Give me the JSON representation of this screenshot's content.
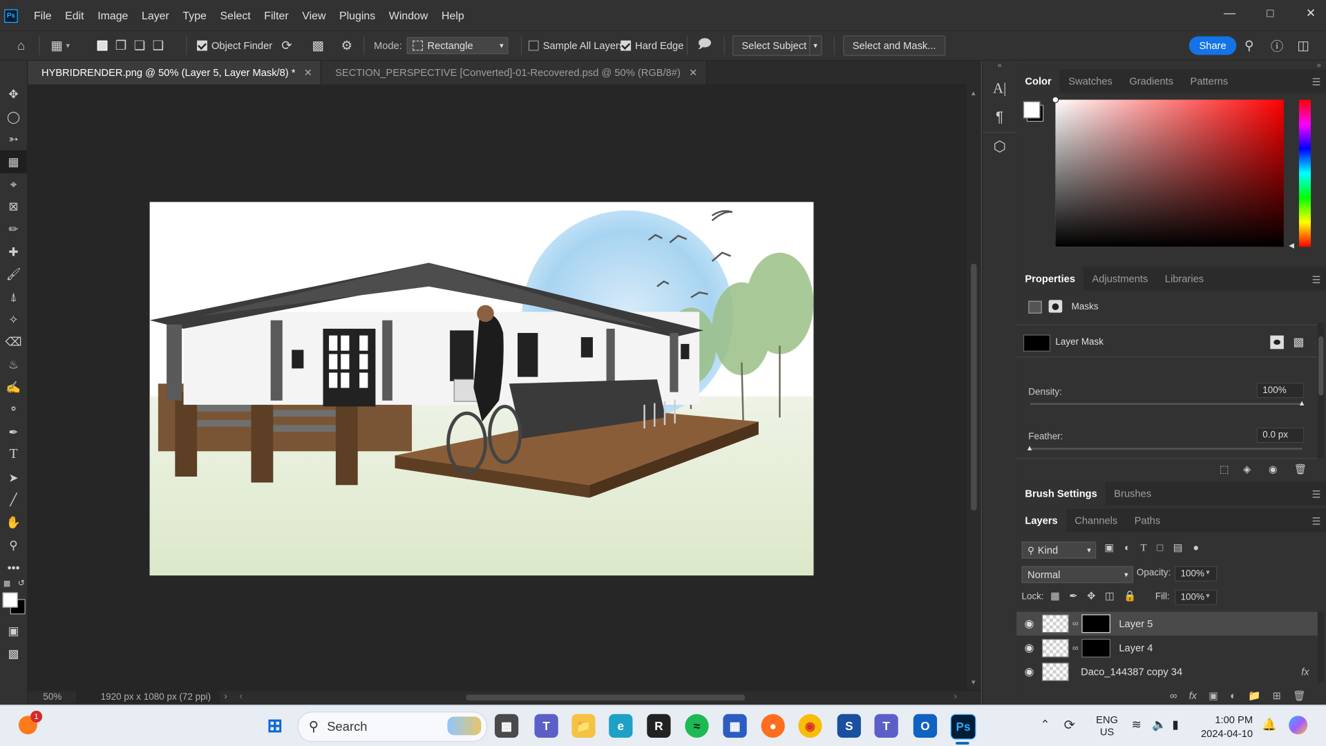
{
  "app": {
    "logo": "Ps",
    "menus": [
      "File",
      "Edit",
      "Image",
      "Layer",
      "Type",
      "Select",
      "Filter",
      "View",
      "Plugins",
      "Window",
      "Help"
    ]
  },
  "options": {
    "object_finder": "Object Finder",
    "mode_label": "Mode:",
    "mode_value": "Rectangle",
    "sample_all_layers": "Sample All Layers",
    "hard_edge": "Hard Edge",
    "select_subject": "Select Subject",
    "select_and_mask": "Select and Mask...",
    "share": "Share"
  },
  "tabs": [
    {
      "label": "HYBRIDRENDER.png @ 50% (Layer 5, Layer Mask/8) *",
      "active": true
    },
    {
      "label": "SECTION_PERSPECTIVE [Converted]-01-Recovered.psd @ 50% (RGB/8#)",
      "active": false
    }
  ],
  "status": {
    "zoom": "50%",
    "doc_info": "1920 px x 1080 px (72 ppi)"
  },
  "color_panel": {
    "tabs": [
      "Color",
      "Swatches",
      "Gradients",
      "Patterns"
    ]
  },
  "properties_panel": {
    "tabs": [
      "Properties",
      "Adjustments",
      "Libraries"
    ],
    "section": "Masks",
    "mask_label": "Layer Mask",
    "density_label": "Density:",
    "density_value": "100%",
    "density_fraction": 1.0,
    "feather_label": "Feather:",
    "feather_value": "0.0 px",
    "feather_fraction": 0.0
  },
  "brush_panel": {
    "tabs": [
      "Brush Settings",
      "Brushes"
    ]
  },
  "layers_panel": {
    "tabs": [
      "Layers",
      "Channels",
      "Paths"
    ],
    "filter_kind": "Kind",
    "blend_mode": "Normal",
    "opacity_label": "Opacity:",
    "opacity_value": "100%",
    "lock_label": "Lock:",
    "fill_label": "Fill:",
    "fill_value": "100%",
    "layers": [
      {
        "name": "Layer 5",
        "selected": true
      },
      {
        "name": "Layer 4",
        "selected": false
      },
      {
        "name": "Daco_144387 copy 34",
        "selected": false
      }
    ]
  },
  "taskbar": {
    "search_placeholder": "Search",
    "notification_count": "1",
    "lang_line1": "ENG",
    "lang_line2": "US",
    "time": "1:00 PM",
    "date": "2024-04-10"
  }
}
